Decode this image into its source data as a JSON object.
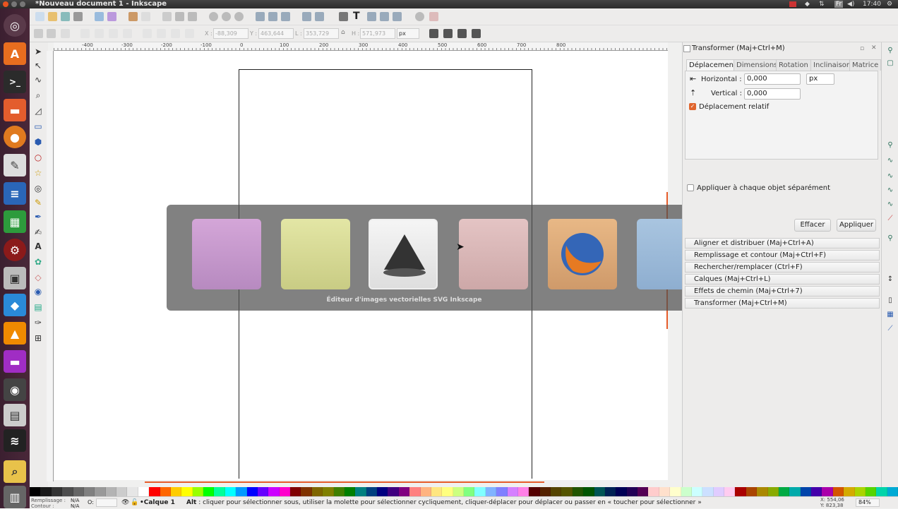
{
  "window": {
    "title": "*Nouveau document 1 - Inkscape"
  },
  "tray": {
    "keyboard": "Fr",
    "time": "17:40"
  },
  "launcher": {
    "items": [
      "ubuntu-dash-icon",
      "software-center-icon",
      "terminal-icon",
      "files-icon",
      "firefox-icon",
      "text-editor-icon",
      "writer-icon",
      "calc-icon",
      "settings-icon",
      "screenshot-icon",
      "dropbox-icon",
      "vlc-icon",
      "impress-icon",
      "camera-icon",
      "usb-icon",
      "stacks-icon",
      "image-viewer-icon",
      "trash-icon"
    ]
  },
  "controls": {
    "x_label": "X :",
    "x_value": "-88,309",
    "y_label": "Y :",
    "y_value": "463,644",
    "w_label": "L :",
    "w_value": "353,729",
    "h_label": "H :",
    "h_value": "571,973",
    "unit": "px"
  },
  "ruler": {
    "top_labels": [
      "-400",
      "-300",
      "-200",
      "-100",
      "0",
      "100",
      "200",
      "300",
      "400",
      "500",
      "600",
      "700",
      "800"
    ]
  },
  "switcher": {
    "label": "Éditeur d'images vectorielles SVG Inkscape",
    "apps": [
      "app-icon",
      "image-viewer-icon",
      "inkscape-icon",
      "file-cabinet-icon",
      "firefox-icon",
      "document-icon"
    ]
  },
  "dock": {
    "title": "Transformer (Maj+Ctrl+M)",
    "tabs": [
      "Déplacement",
      "Dimensions",
      "Rotation",
      "Inclinaison",
      "Matrice"
    ],
    "horizontal_label": "Horizontal :",
    "horizontal_value": "0,000",
    "vertical_label": "Vertical :",
    "vertical_value": "0,000",
    "unit": "px",
    "relative_label": "Déplacement relatif",
    "separately_label": "Appliquer à chaque objet séparément",
    "clear_button": "Effacer",
    "apply_button": "Appliquer",
    "dialogs": [
      "Aligner et distribuer (Maj+Ctrl+A)",
      "Remplissage et contour (Maj+Ctrl+F)",
      "Rechercher/remplacer (Ctrl+F)",
      "Calques (Maj+Ctrl+L)",
      "Effets de chemin (Maj+Ctrl+7)",
      "Transformer (Maj+Ctrl+M)"
    ]
  },
  "palette": {
    "colors": [
      "#000000",
      "#1a1a1a",
      "#333333",
      "#4d4d4d",
      "#666666",
      "#808080",
      "#999999",
      "#b3b3b3",
      "#cccccc",
      "#e6e6e6",
      "#ffffff",
      "#ff0000",
      "#ff6600",
      "#ffcc00",
      "#ffff00",
      "#99ff00",
      "#00ff00",
      "#00ff99",
      "#00ffff",
      "#0099ff",
      "#0000ff",
      "#6600ff",
      "#cc00ff",
      "#ff00cc",
      "#800000",
      "#803300",
      "#806600",
      "#808000",
      "#408000",
      "#008000",
      "#008080",
      "#004080",
      "#000080",
      "#400080",
      "#800080",
      "#ff8080",
      "#ffb380",
      "#ffe680",
      "#ffff80",
      "#ccff80",
      "#80ff80",
      "#80ffff",
      "#80b3ff",
      "#8080ff",
      "#d580ff",
      "#ff80e6",
      "#550000",
      "#552200",
      "#554400",
      "#555500",
      "#225500",
      "#005500",
      "#005555",
      "#002255",
      "#000055",
      "#220055",
      "#550055",
      "#ffcccc",
      "#ffe0cc",
      "#ffffcc",
      "#ccffcc",
      "#ccffff",
      "#cce0ff",
      "#e0ccff",
      "#ffccf0",
      "#aa0000",
      "#aa4400",
      "#aa8800",
      "#88aa00",
      "#00aa44",
      "#00aaaa",
      "#0044aa",
      "#4400aa",
      "#aa00aa",
      "#d45500",
      "#d4aa00",
      "#aad400",
      "#55d400",
      "#00d4aa",
      "#00aad4"
    ]
  },
  "status": {
    "fill_label": "Remplissage :",
    "fill_value": "N/A",
    "stroke_label": "Contour :",
    "stroke_value": "N/A",
    "opacity_label": "O:",
    "layer": "•Calque 1",
    "message_bold": "Alt",
    "message": " : cliquer pour sélectionner sous, utiliser la molette pour sélectionner cycliquement, cliquer-déplacer pour déplacer ou passer en « toucher pour sélectionner »",
    "x_coord": "X: 554,06",
    "y_coord": "Y: 823,38",
    "zoom": "84%"
  }
}
